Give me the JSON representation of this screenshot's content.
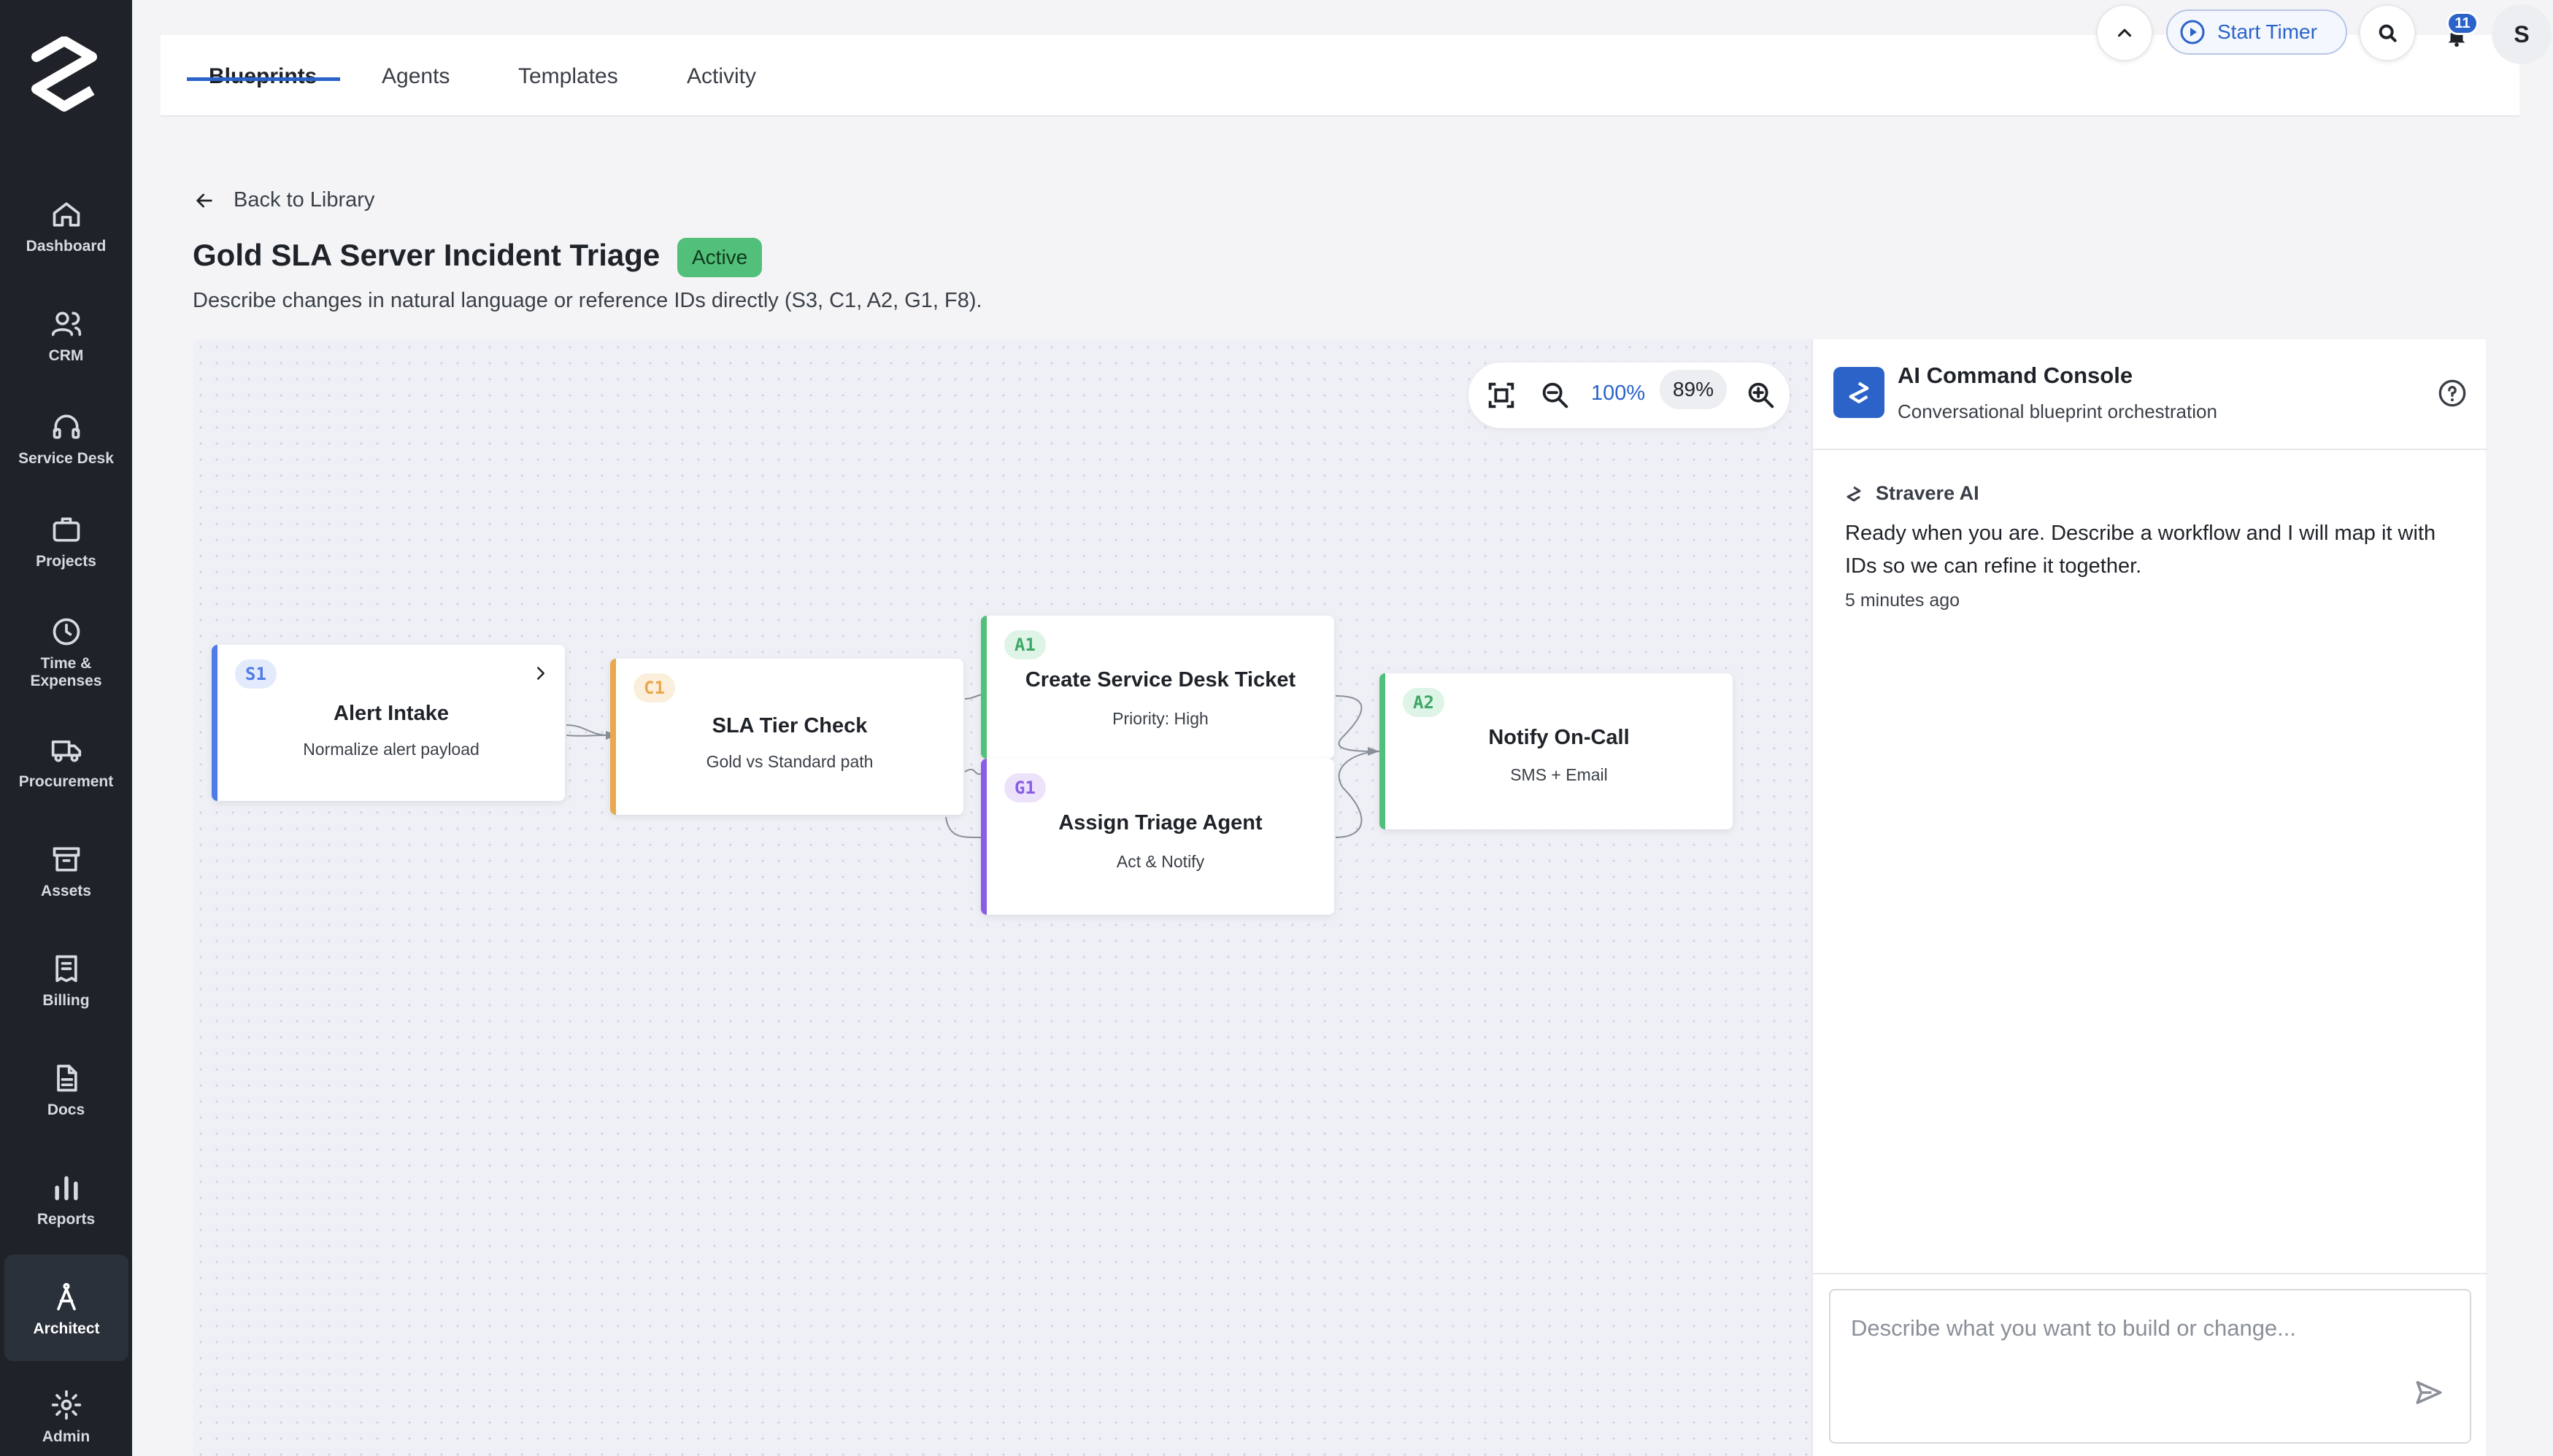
{
  "sidebar": {
    "items": [
      {
        "label": "Dashboard",
        "icon": "home-icon"
      },
      {
        "label": "CRM",
        "icon": "users-icon"
      },
      {
        "label": "Service Desk",
        "icon": "headset-icon"
      },
      {
        "label": "Projects",
        "icon": "briefcase-icon"
      },
      {
        "label": "Time & Expenses",
        "icon": "clock-icon"
      },
      {
        "label": "Procurement",
        "icon": "truck-icon"
      },
      {
        "label": "Assets",
        "icon": "archive-icon"
      },
      {
        "label": "Billing",
        "icon": "receipt-icon"
      },
      {
        "label": "Docs",
        "icon": "document-icon"
      },
      {
        "label": "Reports",
        "icon": "bar-chart-icon"
      },
      {
        "label": "Architect",
        "icon": "compass-icon",
        "active": true
      },
      {
        "label": "Admin",
        "icon": "gear-icon"
      }
    ]
  },
  "tabs": [
    {
      "label": "Blueprints",
      "active": true
    },
    {
      "label": "Agents"
    },
    {
      "label": "Templates"
    },
    {
      "label": "Activity"
    }
  ],
  "topbar": {
    "timer_label": "Start Timer",
    "notification_count": "11",
    "avatar_initial": "S"
  },
  "header": {
    "back_label": "Back to Library",
    "title": "Gold SLA Server Incident Triage",
    "status": "Active",
    "subtitle": "Describe changes in natural language or reference IDs directly (S3, C1, A2, G1, F8)."
  },
  "zoom": {
    "value": "100%",
    "pill": "89%"
  },
  "nodes": [
    {
      "id": "S1",
      "title": "Alert Intake",
      "sub": "Normalize alert payload",
      "color": "#4f7be8"
    },
    {
      "id": "C1",
      "title": "SLA Tier Check",
      "sub": "Gold vs Standard path",
      "color": "#e8a84f"
    },
    {
      "id": "A1",
      "title": "Create Service Desk Ticket",
      "sub": "Priority: High",
      "color": "#52c07a"
    },
    {
      "id": "G1",
      "title": "Assign Triage Agent",
      "sub": "Act & Notify",
      "color": "#8a5ce6"
    },
    {
      "id": "A2",
      "title": "Notify On-Call",
      "sub": "SMS + Email",
      "color": "#52c07a"
    }
  ],
  "panel": {
    "title": "AI Command Console",
    "subtitle": "Conversational blueprint orchestration",
    "author": "Stravere AI",
    "message": "Ready when you are. Describe a workflow and I will map it with IDs so we can refine it together.",
    "time": "5 minutes ago",
    "input_placeholder": "Describe what you want to build or change..."
  },
  "colors": {
    "sidebar_bg": "#1f2329",
    "accent": "#2b63c9",
    "active_green": "#52c07a"
  }
}
